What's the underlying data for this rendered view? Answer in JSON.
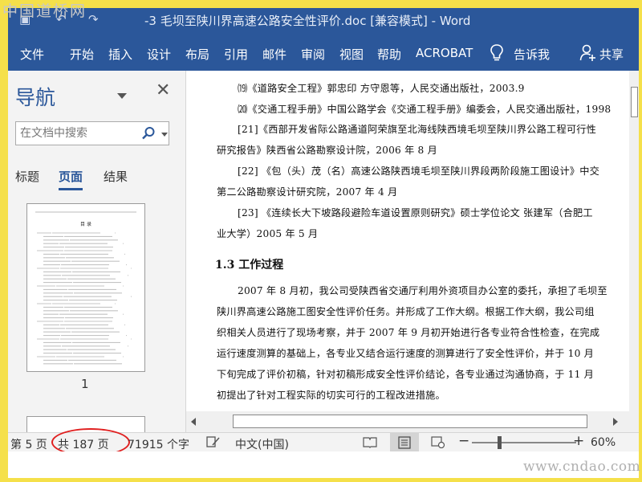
{
  "watermark": {
    "top": "中国道桥网",
    "bottom": "www.cndao.com"
  },
  "window": {
    "title": "-3 毛坝至陕川界高速公路安全性评价.doc [兼容模式] - Word"
  },
  "ribbon": {
    "tabs": [
      "文件",
      "开始",
      "插入",
      "设计",
      "布局",
      "引用",
      "邮件",
      "审阅",
      "视图",
      "帮助",
      "ACROBAT"
    ],
    "tell_me": "告诉我",
    "share": "共享"
  },
  "nav": {
    "title": "导航",
    "search_placeholder": "在文档中搜索",
    "tabs": [
      "标题",
      "页面",
      "结果"
    ],
    "active_tab": "页面",
    "thumb_title": "目  录",
    "thumb_page_number": "1"
  },
  "document": {
    "refs": [
      "⒆《道路安全工程》郭忠印 方守恩等，人民交通出版社，2003.9",
      "⒇《交通工程手册》中国公路学会《交通工程手册》编委会，人民交通出版社，1998",
      "[21]《西部开发省际公路通道阿荣旗至北海线陕西境毛坝至陕川界公路工程可行性",
      "研究报告》陕西省公路勘察设计院，2006 年 8 月",
      "[22] 《包（头）茂（名）高速公路陕西境毛坝至陕川界段两阶段施工图设计》中交",
      "第二公路勘察设计研究院，2007 年 4 月",
      "[23] 《连续长大下坡路段避险车道设置原则研究》硕士学位论文  张建军（合肥工",
      "业大学）2005 年 5 月"
    ],
    "section_heading": "1.3 工作过程",
    "body_lines": [
      "2007 年 8 月初，我公司受陕西省交通厅利用外资项目办公室的委托，承担了毛坝至",
      "陕川界高速公路施工图安全性评价任务。并形成了工作大纲。根据工作大纲，我公司组",
      "织相关人员进行了现场考察，并于 2007 年 9 月初开始进行各专业符合性检查，在完成",
      "运行速度测算的基础上，各专业又结合运行速度的测算进行了安全性评价，并于 10 月",
      "下旬完成了评价初稿，针对初稿形成安全性评价结论，各专业通过沟通协商，于 11 月",
      "初提出了针对工程实际的切实可行的工程改进措施。"
    ]
  },
  "status": {
    "page": "第 5 页",
    "total": "共 187 页",
    "words": "71915 个字",
    "language": "中文(中国)",
    "zoom": "60%",
    "zoom_level": 0.6
  },
  "colors": {
    "brand": "#2b579a",
    "frame": "#f5e04a",
    "highlight_circle": "#e02020"
  }
}
